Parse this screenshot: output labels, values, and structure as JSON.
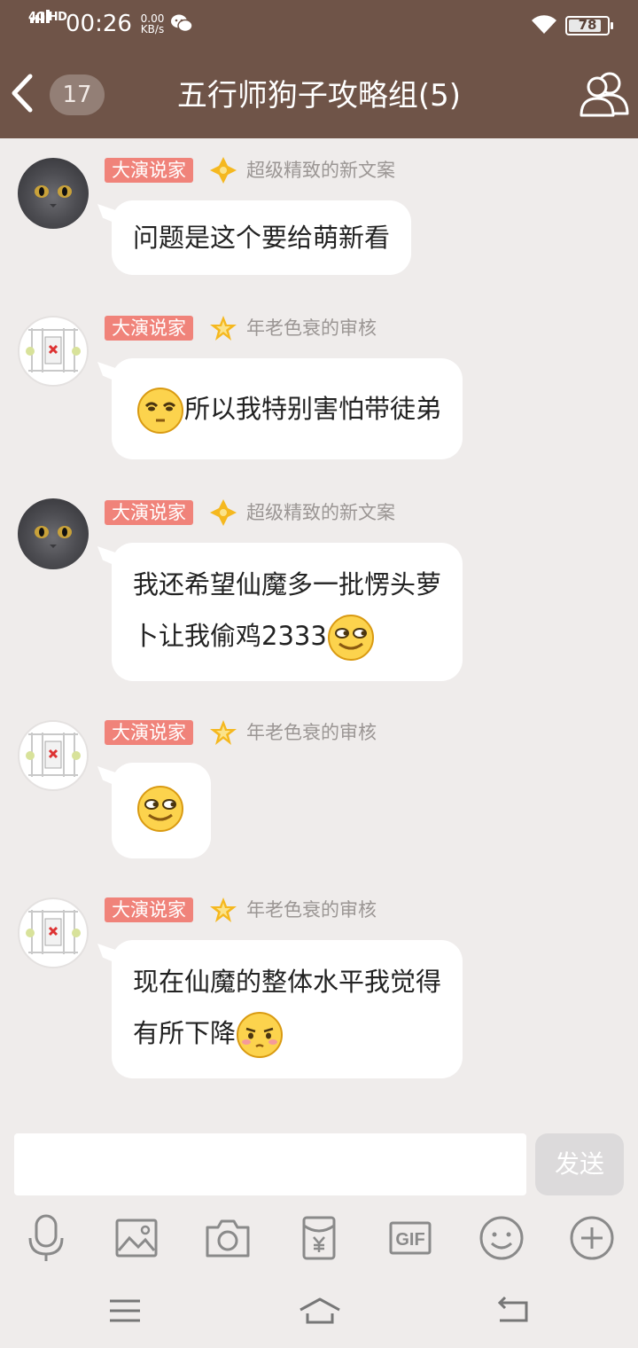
{
  "status_bar": {
    "network": "4G HD",
    "time": "00:26",
    "speed_value": "0.00",
    "speed_unit": "KB/s",
    "battery": "78"
  },
  "header": {
    "back_icon": "chevron-left-icon",
    "unread_count": "17",
    "title": "五行师狗子攻略组(5)",
    "members_icon": "group-members-icon"
  },
  "messages": [
    {
      "avatar": "cat",
      "tag": "大演说家",
      "title_icon": "diamond-badge-icon",
      "title": "超级精致的新文案",
      "lines": [
        [
          "问题是这个要给萌新看"
        ]
      ]
    },
    {
      "avatar": "grid",
      "tag": "大演说家",
      "title_icon": "star-badge-icon",
      "title": "年老色衰的审核",
      "lines": [
        [
          "[emoji:sleepy]",
          "所以我特别害怕带徒弟"
        ]
      ]
    },
    {
      "avatar": "cat",
      "tag": "大演说家",
      "title_icon": "diamond-badge-icon",
      "title": "超级精致的新文案",
      "lines": [
        [
          "我还希望仙魔多一批愣头萝"
        ],
        [
          "卜让我偷鸡2333",
          "[emoji:smirk]"
        ]
      ]
    },
    {
      "avatar": "grid",
      "tag": "大演说家",
      "title_icon": "star-badge-icon",
      "title": "年老色衰的审核",
      "lines": [
        [
          "[emoji:smirk]"
        ]
      ]
    },
    {
      "avatar": "grid",
      "tag": "大演说家",
      "title_icon": "star-badge-icon",
      "title": "年老色衰的审核",
      "lines": [
        [
          "现在仙魔的整体水平我觉得"
        ],
        [
          "有所下降",
          "[emoji:shy]"
        ]
      ]
    }
  ],
  "input": {
    "placeholder": "",
    "send_label": "发送"
  },
  "toolbar": [
    "microphone-icon",
    "image-icon",
    "camera-icon",
    "red-packet-icon",
    "gif-icon",
    "emoji-icon",
    "plus-icon"
  ],
  "nav": [
    "menu-icon",
    "home-icon",
    "back-icon"
  ],
  "colors": {
    "header_bg": "#6f5448",
    "chat_bg": "#efeceb",
    "tag_bg": "#f0837a",
    "meta_text": "#9b9694"
  }
}
